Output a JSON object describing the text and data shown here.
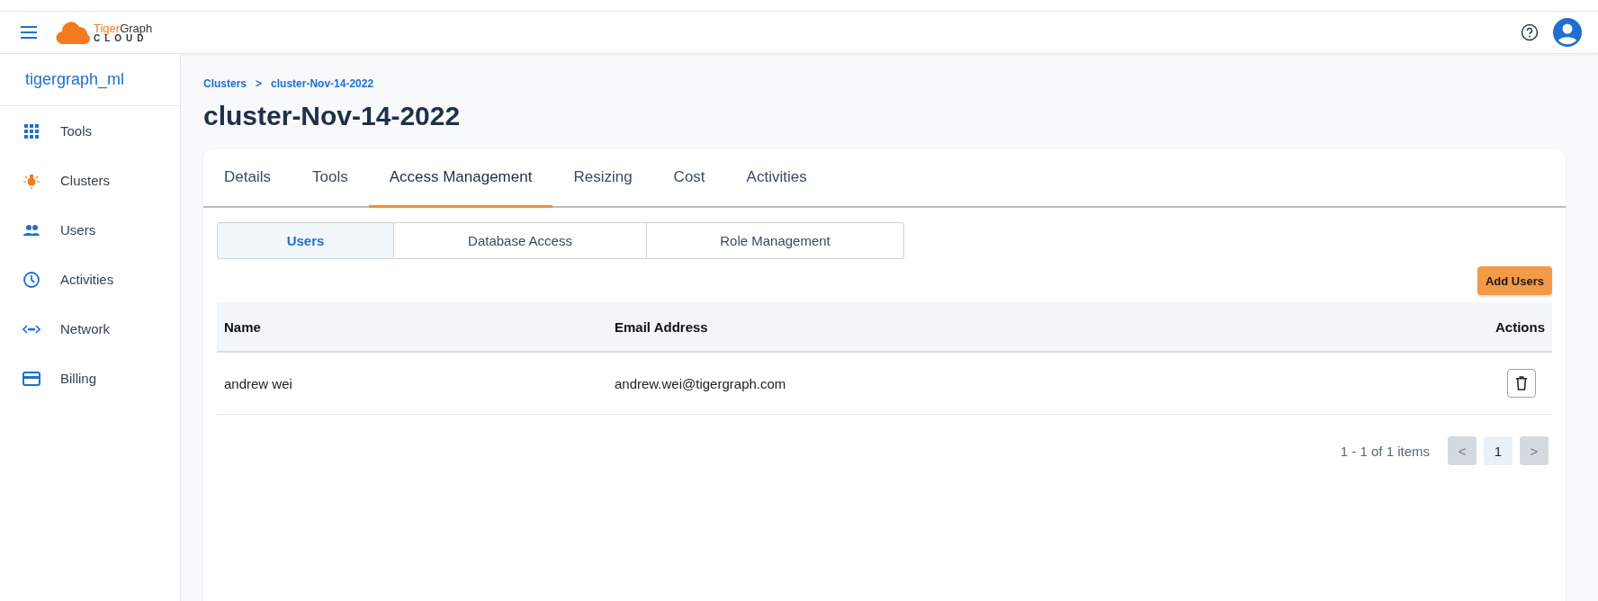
{
  "logo": {
    "accent": "Tiger",
    "rest": "Graph",
    "subtitle": "CLOUD"
  },
  "sidebar": {
    "workspace": "tigergraph_ml",
    "items": [
      {
        "label": "Tools",
        "kind": "grid"
      },
      {
        "label": "Clusters",
        "kind": "bulb"
      },
      {
        "label": "Users",
        "kind": "people"
      },
      {
        "label": "Activities",
        "kind": "clock"
      },
      {
        "label": "Network",
        "kind": "network"
      },
      {
        "label": "Billing",
        "kind": "card"
      }
    ]
  },
  "breadcrumb": [
    {
      "label": "Clusters"
    },
    {
      "label": ">"
    },
    {
      "label": "cluster-Nov-14-2022"
    }
  ],
  "title": "cluster-Nov-14-2022",
  "tabs": [
    {
      "label": "Details",
      "selected": false
    },
    {
      "label": "Tools",
      "selected": false
    },
    {
      "label": "Access Management",
      "selected": true
    },
    {
      "label": "Resizing",
      "selected": false
    },
    {
      "label": "Cost",
      "selected": false
    },
    {
      "label": "Activities",
      "selected": false
    }
  ],
  "subtabs": [
    {
      "label": "Users",
      "selected": true
    },
    {
      "label": "Database Access",
      "selected": false
    },
    {
      "label": "Role Management",
      "selected": false
    }
  ],
  "add_button": "Add Users",
  "table": {
    "columns": [
      "Name",
      "Email Address",
      "Actions"
    ],
    "rows": [
      {
        "name": "andrew wei",
        "email": "andrew.wei@tigergraph.com"
      }
    ]
  },
  "pagination": {
    "summary": "1 - 1 of 1 items",
    "prev": {
      "label": "<",
      "disabled": true
    },
    "pages": [
      {
        "label": "1",
        "selected": true
      }
    ],
    "next": {
      "label": ">",
      "disabled": true
    }
  }
}
